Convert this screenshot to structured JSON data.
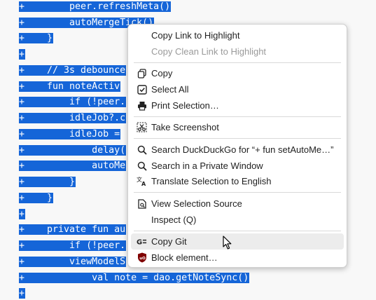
{
  "code_lines": [
    "+        peer.refreshMeta()",
    "+        autoMergeTick()",
    "+    }",
    "+",
    "+    // 3s debounce",
    "+    fun noteActiv",
    "+        if (!peer.",
    "+        idleJob?.c",
    "+        idleJob =",
    "+            delay(",
    "+            autoMe",
    "+        }",
    "+    }",
    "+",
    "+    private fun au",
    "+        if (!peer.",
    "+        viewModelS",
    "+            val note = dao.getNoteSync()",
    "+"
  ],
  "menu": {
    "copy_link_highlight": "Copy Link to Highlight",
    "copy_clean_link_highlight": "Copy Clean Link to Highlight",
    "copy": "Copy",
    "select_all": "Select All",
    "print_selection": "Print Selection…",
    "take_screenshot": "Take Screenshot",
    "search_duckduckgo": "Search DuckDuckGo for “+ fun setAutoMe…”",
    "search_private": "Search in a Private Window",
    "translate": "Translate Selection to English",
    "view_source": "View Selection Source",
    "inspect": "Inspect (Q)",
    "copy_git": "Copy Git",
    "block_element": "Block element…"
  },
  "colors": {
    "selection": "#1565d8",
    "ublock_red": "#800000"
  }
}
